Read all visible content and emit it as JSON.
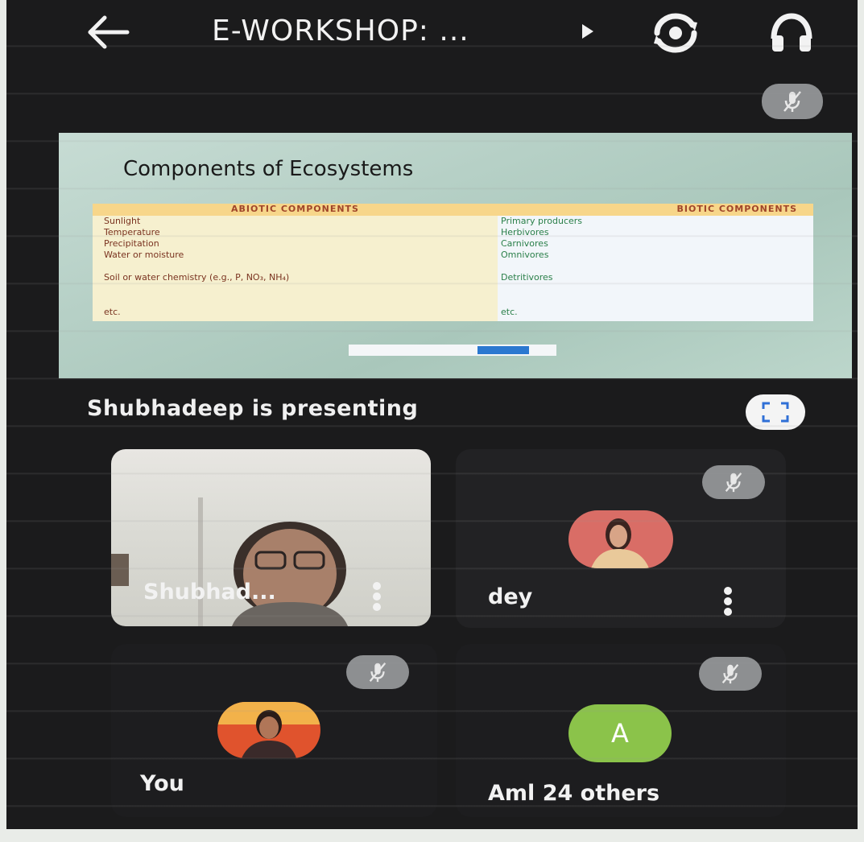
{
  "app": {
    "title": "E-WORKSHOP: ...",
    "back_icon": "arrow-left-icon",
    "switch_camera_icon": "switch-camera-icon",
    "audio_icon": "headphones-icon"
  },
  "presentation": {
    "slide_title": "Components of Ecosystems",
    "abiotic_header": "ABIOTIC COMPONENTS",
    "biotic_header": "BIOTIC COMPONENTS",
    "abiotic_items": [
      "Sunlight",
      "Temperature",
      "Precipitation",
      "Water or moisture",
      "Soil or water chemistry (e.g., P, NO₃, NH₄)",
      "etc."
    ],
    "biotic_items": [
      "Primary producers",
      "Herbivores",
      "Carnivores",
      "Omnivores",
      "Detritivores",
      "etc."
    ],
    "presenting_label": "Shubhadeep is presenting",
    "fullscreen_icon": "fullscreen-icon"
  },
  "participants": [
    {
      "name": "Shubhad...",
      "video": true,
      "muted": false
    },
    {
      "name": "dey",
      "video": false,
      "muted": true
    },
    {
      "name": "You",
      "video": false,
      "muted": true
    },
    {
      "name": "Aml",
      "avatar_letter": "A",
      "others_label": "24 others",
      "muted": true
    }
  ],
  "colors": {
    "background": "#1b1b1c",
    "mute_badge": "#8d8f91",
    "avatar_green": "#8bc34a",
    "abiotic_text": "#7a3320",
    "biotic_text": "#2a7f49",
    "header_band": "#f7d68a"
  }
}
